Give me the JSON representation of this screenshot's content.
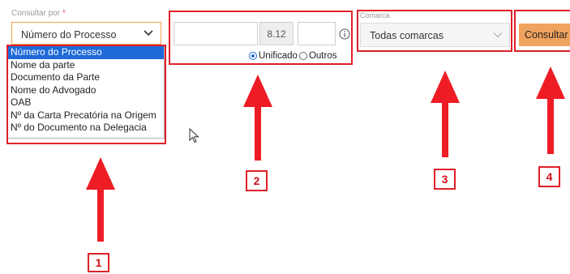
{
  "consultar": {
    "label": "Consultar por",
    "required_mark": "*",
    "selected": "Número do Processo",
    "options": [
      "Número do Processo",
      "Nome da parte",
      "Documento da Parte",
      "Nome do Advogado",
      "OAB",
      "Nº da Carta Precatória na Origem",
      "Nº do Documento na Delegacia"
    ]
  },
  "processo": {
    "segment_middle": "8.12",
    "radio_unificado": "Unificado",
    "radio_outros": "Outros",
    "selected_radio": "Unificado"
  },
  "comarca": {
    "label": "Comarca",
    "selected": "Todas comarcas"
  },
  "actions": {
    "consultar_button": "Consultar"
  },
  "annotations": {
    "labels": [
      "1",
      "2",
      "3",
      "4"
    ],
    "color": "#e0202a"
  }
}
